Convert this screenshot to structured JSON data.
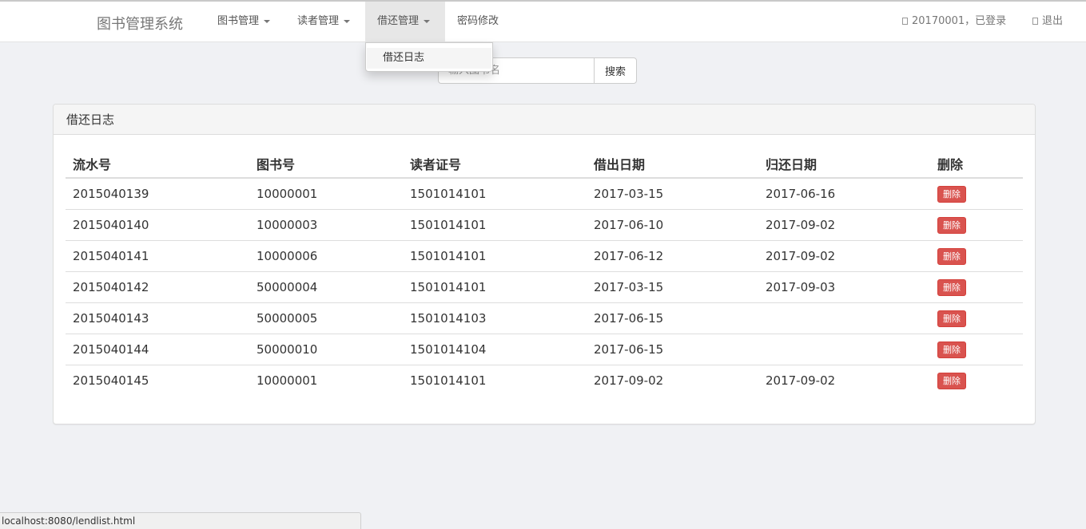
{
  "navbar": {
    "brand": "图书管理系统",
    "menus": [
      {
        "label": "图书管理"
      },
      {
        "label": "读者管理"
      },
      {
        "label": "借还管理"
      },
      {
        "label": "密码修改"
      }
    ],
    "user_status": "20170001，已登录",
    "logout": "退出"
  },
  "dropdown": {
    "items": [
      {
        "label": "借还日志"
      }
    ]
  },
  "search": {
    "placeholder": "输入图书名",
    "button": "搜索"
  },
  "panel": {
    "title": "借还日志",
    "columns": [
      "流水号",
      "图书号",
      "读者证号",
      "借出日期",
      "归还日期",
      "删除"
    ],
    "delete_label": "删除",
    "rows": [
      {
        "serial": "2015040139",
        "book_id": "10000001",
        "reader_id": "1501014101",
        "lend_date": "2017-03-15",
        "return_date": "2017-06-16"
      },
      {
        "serial": "2015040140",
        "book_id": "10000003",
        "reader_id": "1501014101",
        "lend_date": "2017-06-10",
        "return_date": "2017-09-02"
      },
      {
        "serial": "2015040141",
        "book_id": "10000006",
        "reader_id": "1501014101",
        "lend_date": "2017-06-12",
        "return_date": "2017-09-02"
      },
      {
        "serial": "2015040142",
        "book_id": "50000004",
        "reader_id": "1501014101",
        "lend_date": "2017-03-15",
        "return_date": "2017-09-03"
      },
      {
        "serial": "2015040143",
        "book_id": "50000005",
        "reader_id": "1501014103",
        "lend_date": "2017-06-15",
        "return_date": ""
      },
      {
        "serial": "2015040144",
        "book_id": "50000010",
        "reader_id": "1501014104",
        "lend_date": "2017-06-15",
        "return_date": ""
      },
      {
        "serial": "2015040145",
        "book_id": "10000001",
        "reader_id": "1501014101",
        "lend_date": "2017-09-02",
        "return_date": "2017-09-02"
      }
    ]
  },
  "statusbar": {
    "url": "localhost:8080/lendlist.html"
  },
  "colors": {
    "background": "#f0f1f4",
    "danger": "#d9534f",
    "navbar": "#ffffff"
  }
}
